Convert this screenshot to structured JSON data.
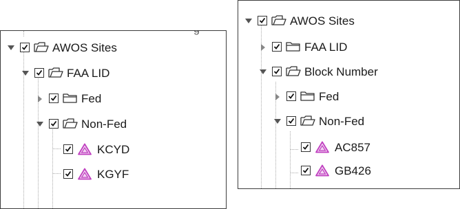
{
  "left_tree": {
    "top_clipped_text": "g",
    "root": {
      "label": "AWOS Sites",
      "checked": true,
      "expanded": true
    },
    "group": {
      "label": "FAA LID",
      "checked": true,
      "expanded": true
    },
    "fed": {
      "label": "Fed",
      "checked": true,
      "expanded": false
    },
    "nonfed": {
      "label": "Non-Fed",
      "checked": true,
      "expanded": true
    },
    "sites": [
      {
        "label": "KCYD",
        "checked": true,
        "icon": "triangle-site-icon"
      },
      {
        "label": "KGYF",
        "checked": true,
        "icon": "triangle-site-icon"
      }
    ]
  },
  "right_tree": {
    "root": {
      "label": "AWOS Sites",
      "checked": true,
      "expanded": true
    },
    "faa_lid": {
      "label": "FAA LID",
      "checked": true,
      "expanded": false
    },
    "group": {
      "label": "Block Number",
      "checked": true,
      "expanded": true
    },
    "fed": {
      "label": "Fed",
      "checked": true,
      "expanded": false
    },
    "nonfed": {
      "label": "Non-Fed",
      "checked": true,
      "expanded": true
    },
    "sites": [
      {
        "label": "AC857",
        "checked": true,
        "icon": "triangle-site-icon"
      },
      {
        "label": "GB426",
        "checked": true,
        "icon": "triangle-site-icon"
      }
    ]
  },
  "colors": {
    "site_triangle": "#c040c0",
    "folder_stroke": "#333333",
    "expander_fill": "#555555",
    "guide_line": "#a9a9a9"
  }
}
